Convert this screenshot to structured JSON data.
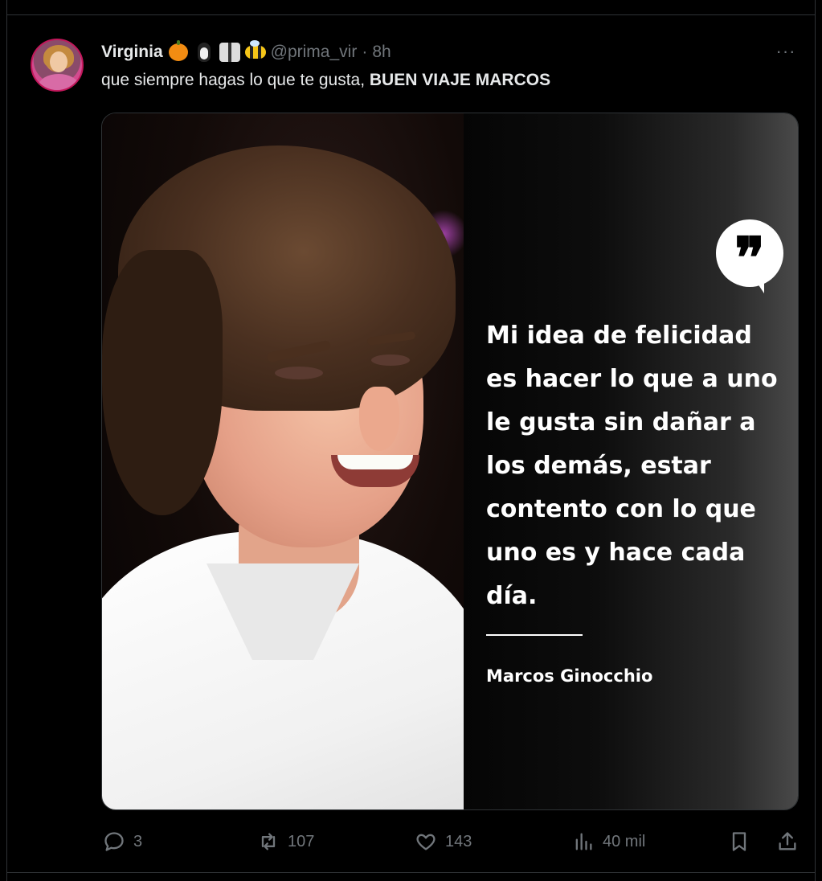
{
  "tweet": {
    "author_name": "Virginia",
    "author_emojis": [
      "pumpkin-emoji",
      "penguin-emoji",
      "martial-arts-gi-emoji",
      "bee-emoji"
    ],
    "handle": "@prima_vir",
    "separator": "·",
    "time": "8h",
    "more_label": "···",
    "text_plain": "que siempre hagas lo que te gusta, ",
    "text_bold": "BUEN VIAJE MARCOS"
  },
  "media": {
    "quote_glyph": "❞",
    "quote_text": "Mi idea de felicidad es hacer lo que a uno le gusta sin dañar a los demás, estar contento con lo que uno es y hace cada día.",
    "quote_lines": [
      "Mi idea de felicidad",
      "es hacer lo que a uno",
      "le gusta sin dañar a",
      "los demás, estar",
      "contento con lo que",
      "uno es y hace cada",
      "día."
    ],
    "author": "Marcos Ginocchio"
  },
  "actions": {
    "replies": "3",
    "reposts": "107",
    "likes": "143",
    "views": "40 mil"
  },
  "colors": {
    "background": "#000000",
    "text": "#e7e9ea",
    "secondary": "#71767b",
    "border": "#2f3336"
  }
}
